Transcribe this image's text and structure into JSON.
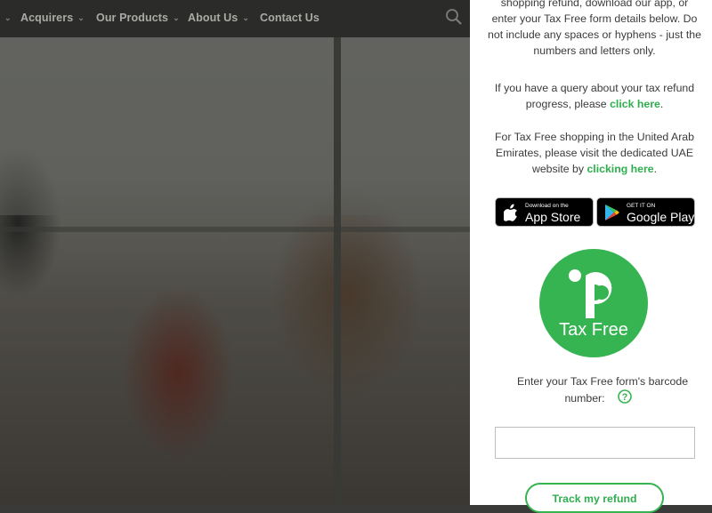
{
  "nav": {
    "items": [
      {
        "label": "Acquirers",
        "has_dropdown": true
      },
      {
        "label": "Our Products",
        "has_dropdown": true
      },
      {
        "label": "About Us",
        "has_dropdown": true
      },
      {
        "label": "Contact Us",
        "has_dropdown": false
      }
    ],
    "search_icon": "search-icon"
  },
  "panel": {
    "intro_lines": [
      "shopping refund, download our app, or",
      "enter your Tax Free form details below. Do",
      "not include any spaces or hyphens - just the",
      "numbers and letters only."
    ],
    "query": {
      "line1": "If you have a query about your tax refund",
      "line2_prefix": "progress, please ",
      "link": "click here",
      "suffix": "."
    },
    "uae": {
      "line1": "For Tax Free shopping in the United Arab",
      "line2": "Emirates, please visit the dedicated UAE",
      "line3_prefix": "website by ",
      "link": "clicking here",
      "suffix": "."
    },
    "app_store": {
      "small": "Download on the",
      "big": "App Store"
    },
    "google_play": {
      "small": "GET IT ON",
      "big": "Google Play"
    },
    "logo_text": "Tax Free",
    "barcode_label_line1": "Enter your Tax Free form's barcode",
    "barcode_label_line2": "number:",
    "barcode_value": "",
    "track_button": "Track my refund",
    "accent_color": "#36b452"
  }
}
